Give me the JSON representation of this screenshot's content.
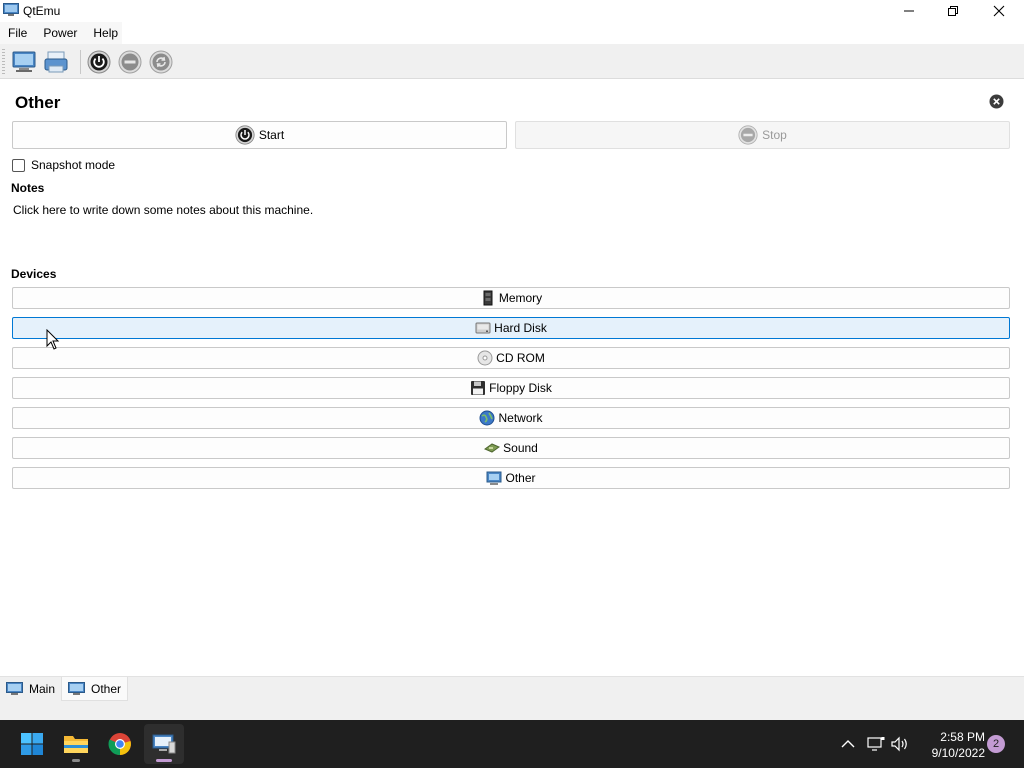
{
  "window": {
    "title": "QtEmu"
  },
  "menu": {
    "file": "File",
    "power": "Power",
    "help": "Help"
  },
  "toolbar": {
    "icons": [
      "new-machine-icon",
      "add-existing-icon",
      "power-on-icon",
      "power-off-icon",
      "reset-icon"
    ]
  },
  "vm": {
    "name": "Other",
    "start_label": "Start",
    "stop_label": "Stop",
    "snapshot_label": "Snapshot mode",
    "snapshot_checked": false,
    "notes_header": "Notes",
    "notes_text": "Click here to write down some notes about this machine.",
    "devices_header": "Devices",
    "devices": [
      {
        "label": "Memory",
        "icon": "memory-icon"
      },
      {
        "label": "Hard Disk",
        "icon": "hard-disk-icon"
      },
      {
        "label": "CD ROM",
        "icon": "cd-rom-icon"
      },
      {
        "label": "Floppy Disk",
        "icon": "floppy-disk-icon"
      },
      {
        "label": "Network",
        "icon": "network-icon"
      },
      {
        "label": "Sound",
        "icon": "sound-icon"
      },
      {
        "label": "Other",
        "icon": "other-device-icon"
      }
    ]
  },
  "tabs": [
    {
      "label": "Main",
      "active": false
    },
    {
      "label": "Other",
      "active": true
    }
  ],
  "taskbar": {
    "time": "2:58 PM",
    "date": "9/10/2022",
    "notification_count": "2",
    "apps": [
      "windows-start-icon",
      "file-explorer-icon",
      "chrome-icon",
      "qtemu-icon"
    ]
  },
  "colors": {
    "hover_bg": "#e5f1fb",
    "hover_border": "#0078d4",
    "taskbar_bg": "#1f1f1f",
    "badge": "#c39bd3"
  }
}
